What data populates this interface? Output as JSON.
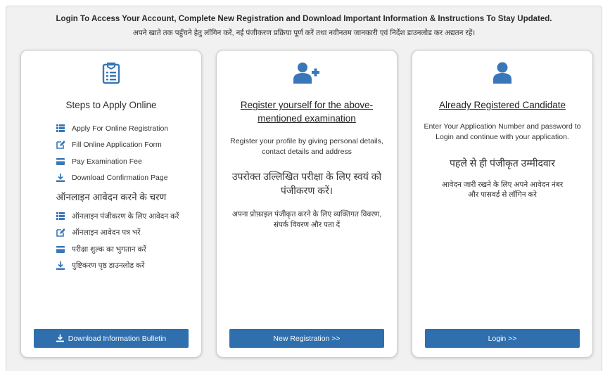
{
  "header": {
    "title_en": "Login To Access Your Account, Complete New Registration and Download Important Information & Instructions To Stay Updated.",
    "title_hi": "अपने खाते तक पहुँचने हेतु लॉगिन करें, नई पंजीकरण प्रक्रिया पूर्ण करें तथा नवीनतम जानकारी एवं निर्देश डाउनलोड कर अद्यतन रहें।"
  },
  "steps_card": {
    "title": "Steps to Apply Online",
    "items_en": [
      {
        "icon": "list-icon",
        "label": "Apply For Online Registration"
      },
      {
        "icon": "edit-icon",
        "label": "Fill Online Application Form"
      },
      {
        "icon": "credit-card-icon",
        "label": "Pay Examination Fee"
      },
      {
        "icon": "download-icon",
        "label": "Download Confirmation Page"
      }
    ],
    "heading_hi": "ऑनलाइन आवेदन करने के चरण",
    "items_hi": [
      {
        "icon": "list-icon",
        "label": "ऑनलाइन पंजीकरण के लिए आवेदन करें"
      },
      {
        "icon": "edit-icon",
        "label": "ऑनलाइन आवेदन पत्र भरें"
      },
      {
        "icon": "credit-card-icon",
        "label": "परीक्षा शुल्क का भुगतान करें"
      },
      {
        "icon": "download-icon",
        "label": "पुष्टिकरण पृष्ठ डाउनलोड करें"
      }
    ],
    "button_label": "Download Information Bulletin"
  },
  "register_card": {
    "title": "Register yourself for the above-mentioned examination",
    "text_en": "Register your profile by giving personal details, contact details and address",
    "title_hi": "उपरोक्त उल्लिखित परीक्षा के लिए स्वयं को पंजीकरण करें।",
    "text_hi": "अपना प्रोफ़ाइल पंजीकृत करने के लिए व्यक्तिगत विवरण, संपर्क विवरण और पता दें",
    "button_label": "New Registration >>"
  },
  "login_card": {
    "title": "Already Registered Candidate",
    "text_en": "Enter Your Application Number and password to Login and continue with your application.",
    "title_hi": "पहले से ही पंजीकृत उम्मीदवार",
    "text_hi": "आवेदन जारी रखने के लिए अपने आवेदन नंबर और पासवर्ड से लॉगिन करे",
    "button_label": "Login >>"
  },
  "colors": {
    "accent": "#2f6fad",
    "icon": "#3a77b8"
  }
}
